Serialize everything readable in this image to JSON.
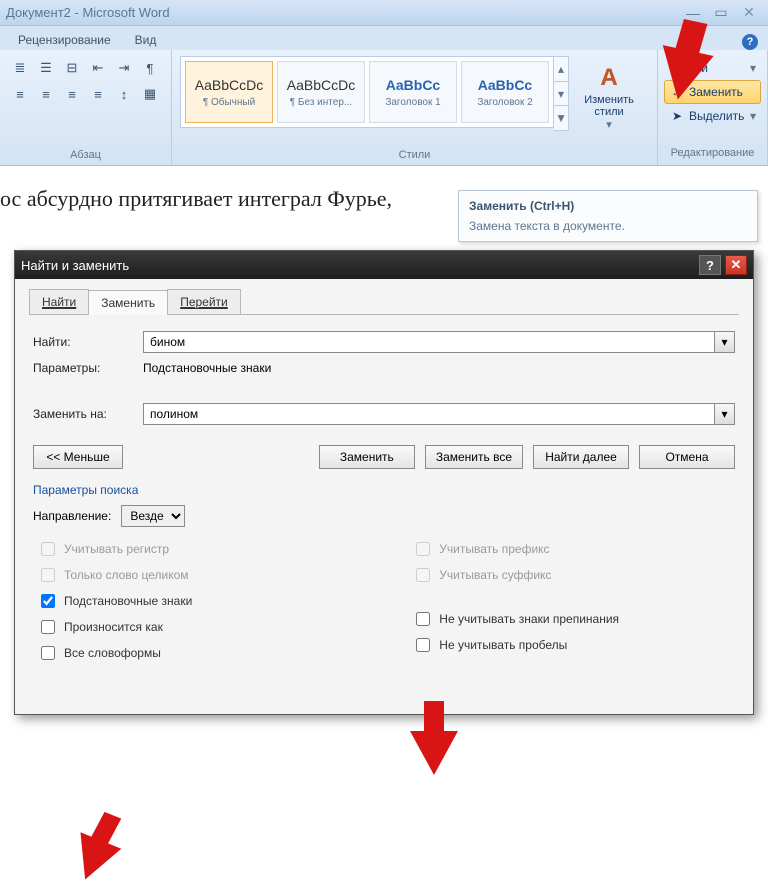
{
  "window": {
    "title": "Документ2 - Microsoft Word"
  },
  "ribbon_tabs": {
    "review": "Рецензирование",
    "view": "Вид"
  },
  "ribbon": {
    "paragraph_label": "Абзац",
    "styles_label": "Стили",
    "editing_label": "Редактирование",
    "styles": {
      "preview": "AaBbCcDc",
      "preview_heading": "AaBbCc",
      "normal": "¶ Обычный",
      "no_spacing": "¶ Без интер...",
      "heading1": "Заголовок 1",
      "heading2": "Заголовок 2"
    },
    "change_styles": "Изменить стили",
    "find": "йти",
    "replace": "Заменить",
    "select": "Выделить"
  },
  "doc_text": "ос абсурдно притягивает интеграл Фурье, ",
  "tooltip": {
    "title": "Заменить (Ctrl+H)",
    "body": "Замена текста в документе."
  },
  "dialog": {
    "title": "Найти и заменить",
    "tabs": {
      "find": "Найти",
      "replace": "Заменить",
      "goto": "Перейти"
    },
    "find_label": "Найти:",
    "find_value": "бином",
    "params_label": "Параметры:",
    "params_value": "Подстановочные знаки",
    "replace_label": "Заменить на:",
    "replace_value": "полином",
    "less_btn": "<< Меньше",
    "replace_btn": "Заменить",
    "replace_all_btn": "Заменить все",
    "find_next_btn": "Найти далее",
    "cancel_btn": "Отмена",
    "search_params_title": "Параметры поиска",
    "direction_label": "Направление:",
    "direction_value": "Везде",
    "chk_case": "Учитывать регистр",
    "chk_whole": "Только слово целиком",
    "chk_wildcards": "Подстановочные знаки",
    "chk_sounds": "Произносится как",
    "chk_forms": "Все словоформы",
    "chk_prefix": "Учитывать префикс",
    "chk_suffix": "Учитывать суффикс",
    "chk_punct": "Не учитывать знаки препинания",
    "chk_spaces": "Не учитывать пробелы"
  }
}
